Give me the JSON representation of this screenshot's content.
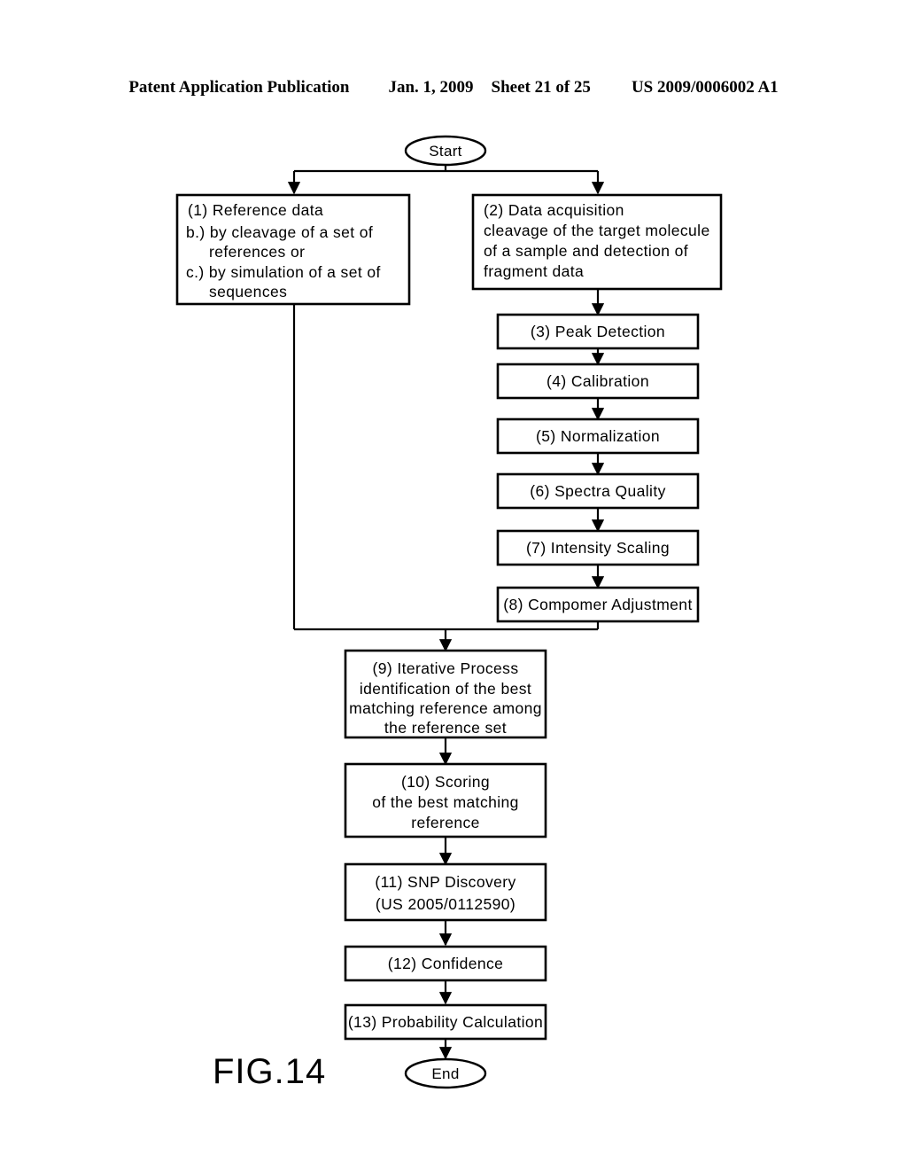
{
  "header": {
    "publication": "Patent Application Publication",
    "date": "Jan. 1, 2009",
    "sheet": "Sheet 21 of 25",
    "doc_number": "US 2009/0006002 A1"
  },
  "figure": {
    "label": "FIG.14",
    "start_label": "Start",
    "end_label": "End"
  },
  "nodes": {
    "n1": {
      "lines": [
        "(1) Reference data",
        "b.) by cleavage of a set of",
        "references or",
        "c.) by simulation of a set of",
        "sequences"
      ]
    },
    "n2": {
      "lines": [
        "(2) Data acquisition",
        "cleavage of the target molecule",
        "of a sample and detection of",
        "fragment data"
      ]
    },
    "n3": {
      "lines": [
        "(3) Peak Detection"
      ]
    },
    "n4": {
      "lines": [
        "(4) Calibration"
      ]
    },
    "n5": {
      "lines": [
        "(5) Normalization"
      ]
    },
    "n6": {
      "lines": [
        "(6) Spectra Quality"
      ]
    },
    "n7": {
      "lines": [
        "(7) Intensity Scaling"
      ]
    },
    "n8": {
      "lines": [
        "(8) Compomer Adjustment"
      ]
    },
    "n9": {
      "lines": [
        "(9) Iterative Process",
        "identification of the best",
        "matching reference among",
        "the reference set"
      ]
    },
    "n10": {
      "lines": [
        "(10) Scoring",
        "of the best matching",
        "reference"
      ]
    },
    "n11": {
      "lines": [
        "(11) SNP Discovery",
        "(US 2005/0112590)"
      ]
    },
    "n12": {
      "lines": [
        "(12) Confidence"
      ]
    },
    "n13": {
      "lines": [
        "(13) Probability Calculation"
      ]
    }
  },
  "colors": {
    "ink": "#000000",
    "paper": "#ffffff"
  }
}
